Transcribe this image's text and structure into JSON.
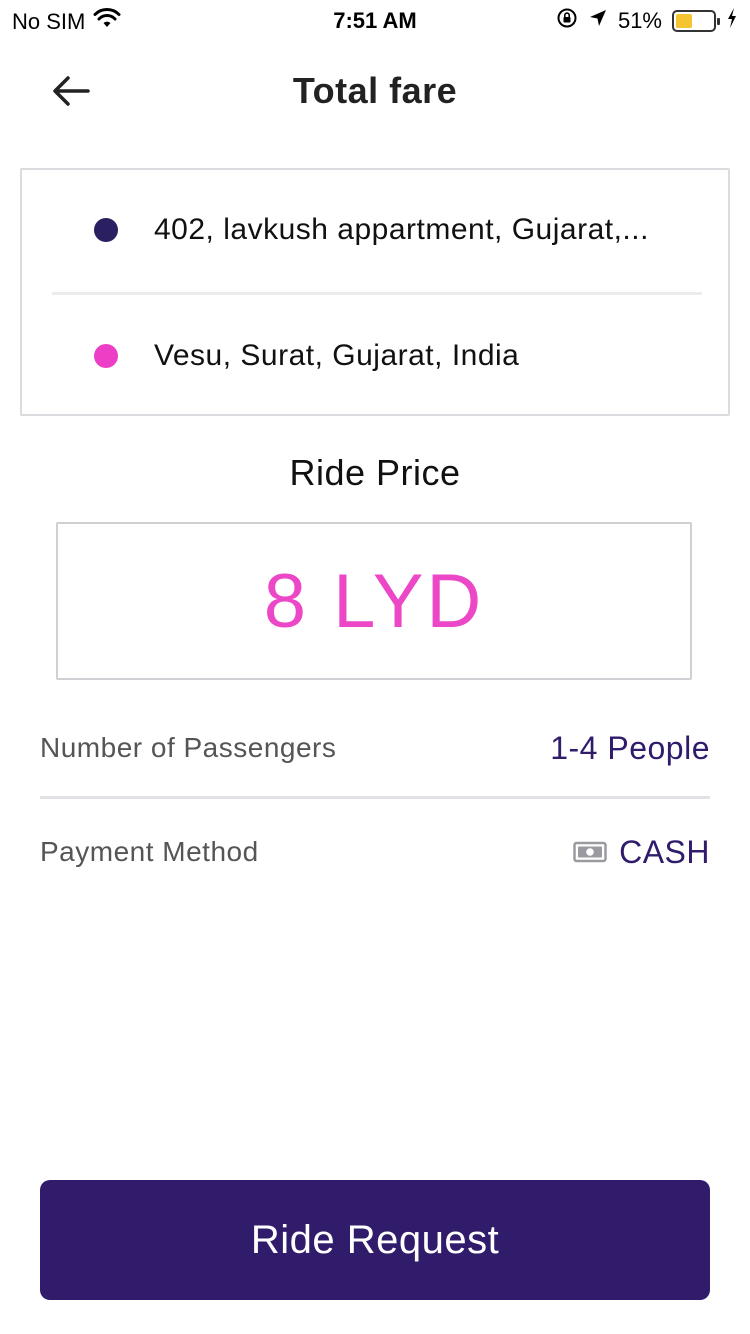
{
  "status_bar": {
    "carrier": "No SIM",
    "time": "7:51 AM",
    "battery_percent": "51%",
    "battery_level": 0.51,
    "icons": [
      "wifi-icon",
      "orientation-lock-icon",
      "location-arrow-icon",
      "battery-icon",
      "charging-bolt-icon"
    ]
  },
  "header": {
    "title": "Total fare",
    "back_icon": "arrow-left-icon"
  },
  "route": {
    "pickup": "402, lavkush appartment, Gujarat,...",
    "drop": "Vesu, Surat, Gujarat, India"
  },
  "price": {
    "label": "Ride Price",
    "value": "8 LYD"
  },
  "details": {
    "passengers_label": "Number of Passengers",
    "passengers_value": "1-4 People",
    "payment_label": "Payment Method",
    "payment_value": "CASH",
    "payment_icon": "cash-icon"
  },
  "action": {
    "request_label": "Ride Request"
  },
  "colors": {
    "primary": "#311c6b",
    "accent_pink": "#ec47c7",
    "pickup_dot": "#2a1f60",
    "drop_dot": "#ec3fc5",
    "battery": "#f4c531"
  }
}
